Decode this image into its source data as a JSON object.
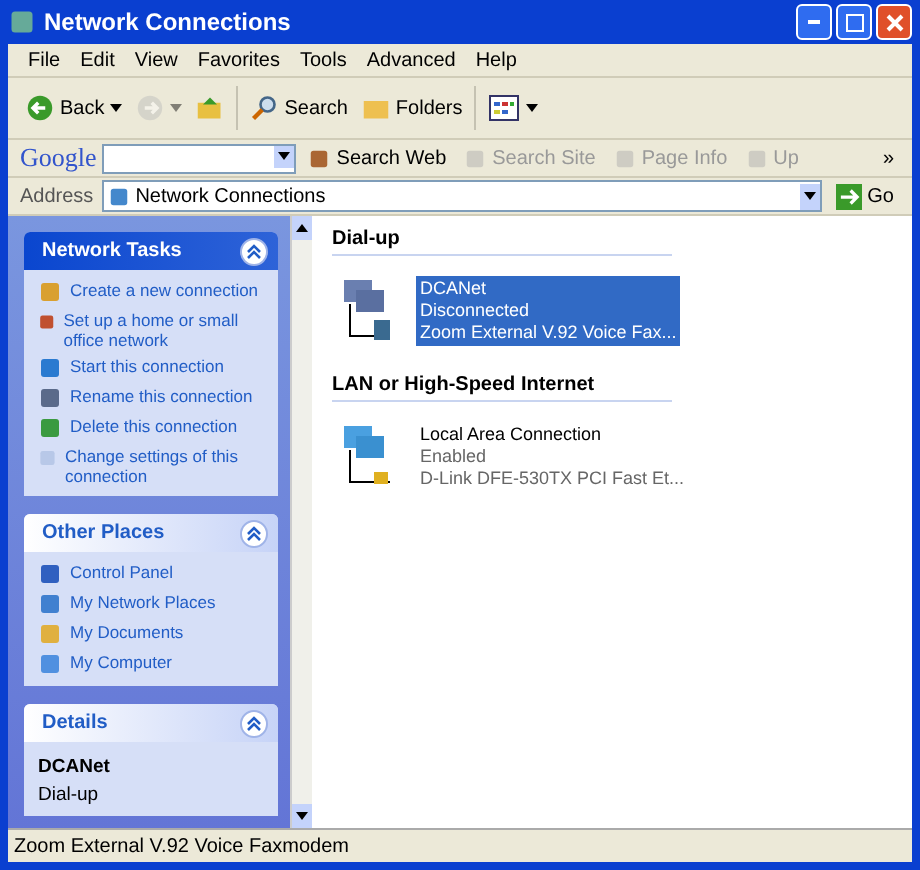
{
  "window": {
    "title": "Network Connections"
  },
  "menu": [
    "File",
    "Edit",
    "View",
    "Favorites",
    "Tools",
    "Advanced",
    "Help"
  ],
  "toolbar": [
    {
      "kind": "back",
      "label": "Back",
      "disabled": false
    },
    {
      "kind": "forward",
      "disabled": true
    },
    {
      "kind": "up",
      "disabled": false
    },
    {
      "kind": "search",
      "label": "Search",
      "disabled": false
    },
    {
      "kind": "folders",
      "label": "Folders",
      "disabled": false
    },
    {
      "kind": "views",
      "disabled": false
    }
  ],
  "google_bar": {
    "logo": "Google",
    "buttons": [
      {
        "label": "Search Web",
        "disabled": false
      },
      {
        "label": "Search Site",
        "disabled": true
      },
      {
        "label": "Page Info",
        "disabled": true
      },
      {
        "label": "Up",
        "disabled": true
      }
    ],
    "more": "»"
  },
  "address_bar": {
    "label": "Address",
    "value": "Network Connections",
    "go": "Go"
  },
  "sidebar": {
    "panels": [
      {
        "kind": "tasks",
        "title": "Network Tasks",
        "expanded": true,
        "items": [
          {
            "label": "Create a new connection"
          },
          {
            "label": "Set up a home or small office network"
          },
          {
            "label": "Start this connection"
          },
          {
            "label": "Rename this connection"
          },
          {
            "label": "Delete this connection"
          },
          {
            "label": "Change settings of this connection"
          }
        ]
      },
      {
        "kind": "places",
        "title": "Other Places",
        "expanded": true,
        "items": [
          {
            "label": "Control Panel"
          },
          {
            "label": "My Network Places"
          },
          {
            "label": "My Documents"
          },
          {
            "label": "My Computer"
          }
        ]
      },
      {
        "kind": "details",
        "title": "Details",
        "expanded": true,
        "name": "DCANet",
        "type": "Dial-up"
      }
    ]
  },
  "groups": [
    {
      "title": "Dial-up",
      "connections": [
        {
          "kind": "dialup",
          "name": "DCANet",
          "status": "Disconnected",
          "device": "Zoom External V.92 Voice Fax...",
          "selected": true
        }
      ]
    },
    {
      "title": "LAN or High-Speed Internet",
      "connections": [
        {
          "kind": "lan",
          "name": "Local Area Connection",
          "status": "Enabled",
          "device": "D-Link DFE-530TX PCI Fast Et...",
          "selected": false
        }
      ]
    }
  ],
  "status_bar": "Zoom External V.92 Voice Faxmodem"
}
